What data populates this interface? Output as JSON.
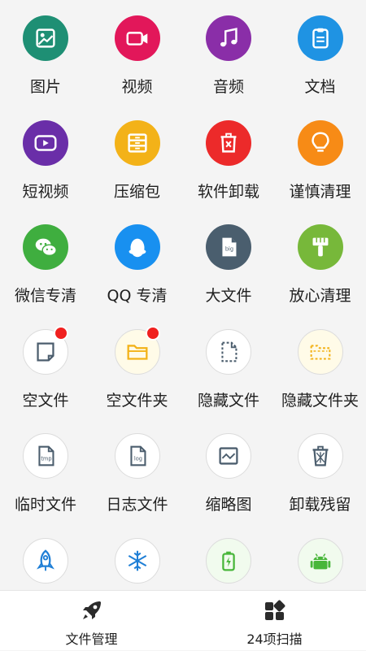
{
  "grid": {
    "items": [
      {
        "label": "图片",
        "icon": "image-icon",
        "color": "#1e8f74"
      },
      {
        "label": "视频",
        "icon": "video-camera-icon",
        "color": "#e2175a"
      },
      {
        "label": "音频",
        "icon": "music-note-icon",
        "color": "#8a2ea8"
      },
      {
        "label": "文档",
        "icon": "clipboard-document-icon",
        "color": "#1f93e3"
      },
      {
        "label": "短视频",
        "icon": "play-screen-icon",
        "color": "#6a2ea8"
      },
      {
        "label": "压缩包",
        "icon": "archive-drawer-icon",
        "color": "#f3b218"
      },
      {
        "label": "软件卸载",
        "icon": "trash-can-icon",
        "color": "#ec2a2a"
      },
      {
        "label": "谨慎清理",
        "icon": "light-bulb-icon",
        "color": "#f78b16"
      },
      {
        "label": "微信专清",
        "icon": "wechat-icon",
        "color": "#3fae3f"
      },
      {
        "label": "QQ 专清",
        "icon": "qq-penguin-icon",
        "color": "#1890f0"
      },
      {
        "label": "大文件",
        "icon": "big-file-icon",
        "color": "#4a5e6e",
        "badge_text": "big"
      },
      {
        "label": "放心清理",
        "icon": "brush-icon",
        "color": "#77b83a"
      },
      {
        "label": "空文件",
        "icon": "empty-file-icon",
        "color": "#ffffff",
        "notification": true
      },
      {
        "label": "空文件夹",
        "icon": "empty-folder-icon",
        "color": "#fffbe8",
        "notification": true
      },
      {
        "label": "隐藏文件",
        "icon": "hidden-file-icon",
        "color": "#ffffff"
      },
      {
        "label": "隐藏文件夹",
        "icon": "hidden-folder-icon",
        "color": "#fffbe8"
      },
      {
        "label": "临时文件",
        "icon": "tmp-file-icon",
        "color": "#ffffff",
        "badge_text": "tmp"
      },
      {
        "label": "日志文件",
        "icon": "log-file-icon",
        "color": "#ffffff",
        "badge_text": "log"
      },
      {
        "label": "缩略图",
        "icon": "thumbnail-image-icon",
        "color": "#ffffff"
      },
      {
        "label": "卸载残留",
        "icon": "recycle-bin-icon",
        "color": "#ffffff"
      },
      {
        "label": "",
        "icon": "rocket-icon",
        "color": "#ffffff"
      },
      {
        "label": "",
        "icon": "snowflake-icon",
        "color": "#ffffff"
      },
      {
        "label": "",
        "icon": "battery-charging-icon",
        "color": "#f1fbee"
      },
      {
        "label": "",
        "icon": "android-icon",
        "color": "#f1fbee"
      }
    ]
  },
  "bottom_nav": {
    "items": [
      {
        "label": "文件管理",
        "icon": "rocket-icon"
      },
      {
        "label": "24项扫描",
        "icon": "apps-grid-icon"
      }
    ]
  }
}
